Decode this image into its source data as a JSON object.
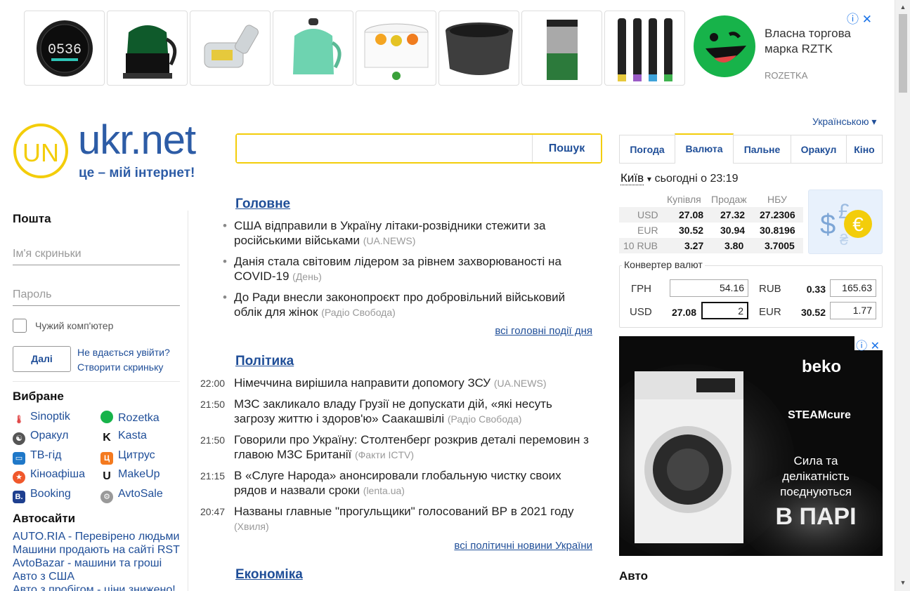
{
  "top_ad": {
    "text": "Власна торгова марка RZTK",
    "brand": "ROZETKA",
    "products": [
      "co2-monitor",
      "electric-kettle-green",
      "vacuum-nozzle",
      "electric-kettle-mint",
      "food-dehydrator",
      "multicooker-bowl",
      "coffee-grinder",
      "toothbrush-heads"
    ]
  },
  "logo": {
    "text": "ukr.net",
    "tagline": "це – мій інтернет!"
  },
  "search": {
    "placeholder": "",
    "button": "Пошук"
  },
  "language": "Українською ▾",
  "mail": {
    "title": "Пошта",
    "username_placeholder": "Ім'я скриньки",
    "password_placeholder": "Пароль",
    "foreign_computer": "Чужий комп'ютер",
    "next": "Далі",
    "cant_login": "Не вдається увійти?",
    "create_box": "Створити скриньку"
  },
  "favorites": {
    "title": "Вибране",
    "items": [
      "Sinoptik",
      "Rozetka",
      "Оракул",
      "Kasta",
      "ТВ-гід",
      "Цитрус",
      "Кіноафіша",
      "MakeUp",
      "Booking",
      "AvtoSale"
    ]
  },
  "auto_sites": {
    "title": "Автосайти",
    "links": [
      "AUTO.RIA - Перевірено людьми",
      "Машини продають на сайті RST",
      "AvtoBazar - машини та гроші",
      "Авто з США",
      "Авто з пробігом - ціни знижено!"
    ]
  },
  "news": {
    "main": {
      "title": "Головне",
      "items": [
        {
          "text": "США відправили в Україну літаки-розвідники стежити за російськими військами",
          "source": "(UA.NEWS)"
        },
        {
          "text": "Данія стала світовим лідером за рівнем захворюваності на COVID-19",
          "source": "(День)"
        },
        {
          "text": "До Ради внесли законопроєкт про добровільний військовий облік для жінок",
          "source": "(Радіо Свобода)"
        }
      ],
      "more": "всі головні події дня"
    },
    "politics": {
      "title": "Політика",
      "items": [
        {
          "time": "22:00",
          "text": "Німеччина вирішила направити допомогу ЗСУ",
          "source": "(UA.NEWS)"
        },
        {
          "time": "21:50",
          "text": "МЗС закликало владу Грузії не допускати дій, «які несуть загрозу життю і здоров'ю» Саакашвілі",
          "source": "(Радіо Свобода)"
        },
        {
          "time": "21:50",
          "text": "Говорили про Україну: Столтенберг розкрив деталі перемовин з главою МЗС Британії",
          "source": "(Факти ICTV)"
        },
        {
          "time": "21:15",
          "text": "В «Слуге Народа» анонсировали глобальную чистку своих рядов и назвали сроки",
          "source": "(lenta.ua)"
        },
        {
          "time": "20:47",
          "text": "Названы главные \"прогульщики\" голосований ВР в 2021 году",
          "source": "(Хвиля)"
        }
      ],
      "more": "всі політичні новини України"
    },
    "economy": {
      "title": "Економіка"
    }
  },
  "tabs": [
    "Погода",
    "Валюта",
    "Пальне",
    "Оракул",
    "Кіно"
  ],
  "currency": {
    "city": "Київ",
    "city_arrow": "▾",
    "today": "сьогодні о 23:19",
    "headers": [
      "Купівля",
      "Продаж",
      "НБУ"
    ],
    "rows": [
      {
        "cur": "USD",
        "buy": "27.08",
        "sell": "27.32",
        "nbu": "27.2306"
      },
      {
        "cur": "EUR",
        "buy": "30.52",
        "sell": "30.94",
        "nbu": "30.8196"
      },
      {
        "cur": "10 RUB",
        "buy": "3.27",
        "sell": "3.80",
        "nbu": "3.7005"
      }
    ]
  },
  "converter": {
    "title": "Конвертер валют",
    "rows": [
      {
        "left_cur": "ГРН",
        "left_rate": "",
        "left_val": "54.16",
        "right_cur": "RUB",
        "right_rate": "0.33",
        "right_val": "165.63"
      },
      {
        "left_cur": "USD",
        "left_rate": "27.08",
        "left_val": "2",
        "right_cur": "EUR",
        "right_rate": "30.52",
        "right_val": "1.77"
      }
    ]
  },
  "side_ad": {
    "brand": "beko",
    "product": "STEAMcure",
    "line1": "Сила та",
    "line2": "делікатність",
    "line3": "поєднуються",
    "line4": "В ПАРІ"
  },
  "right_section": "Авто"
}
